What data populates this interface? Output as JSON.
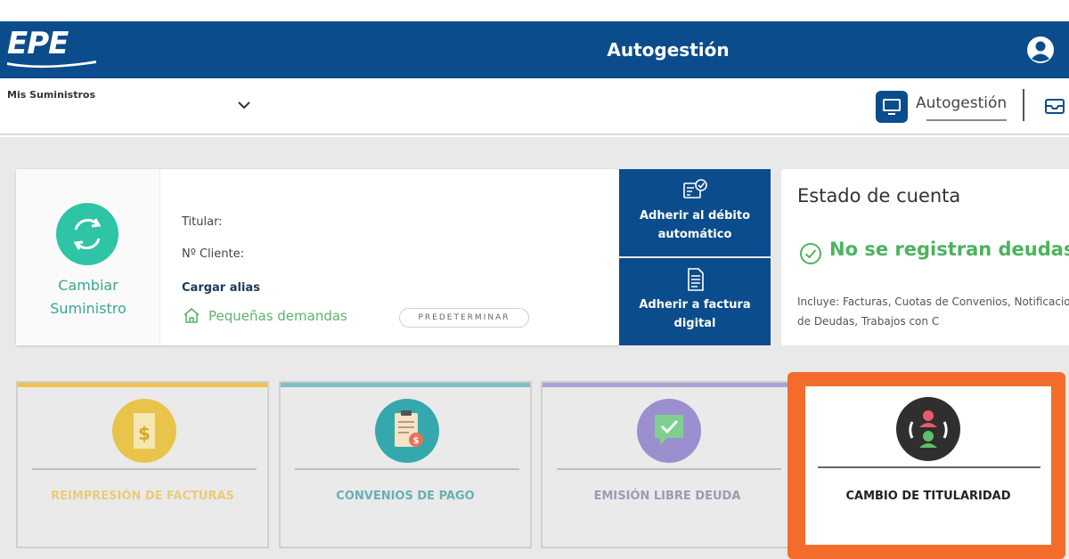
{
  "header": {
    "logo_text": "EPE",
    "title": "Autogestión",
    "user_icon": "user-circle-icon"
  },
  "subnav": {
    "supply_label": "Mis Suministros",
    "nav_label": "Autogestión"
  },
  "supply_card": {
    "change_label_1": "Cambiar",
    "change_label_2": "Suministro",
    "holder_label": "Titular:",
    "client_label": "Nº Cliente:",
    "alias_link": "Cargar alias",
    "category": "Pequeñas demandas",
    "default_tag": "PREDETERMINAR"
  },
  "actions": {
    "debit": "Adherir al débito automático",
    "digital_invoice": "Adherir a factura digital"
  },
  "account_status": {
    "title": "Estado de cuenta",
    "status": "No se registran deudas",
    "includes": "Incluye: Facturas, Cuotas de Convenios, Notificaciones de Deudas, Trabajos con C"
  },
  "tiles": [
    {
      "label": "REIMPRESIÓN DE FACTURAS",
      "icon": "invoice-dollar-icon"
    },
    {
      "label": "CONVENIOS DE PAGO",
      "icon": "clipboard-payment-icon"
    },
    {
      "label": "EMISIÓN LIBRE DEUDA",
      "icon": "chat-check-icon"
    },
    {
      "label": "CAMBIO DE TITULARIDAD",
      "icon": "users-swap-icon"
    }
  ],
  "colors": {
    "brand_blue": "#0b4c8c",
    "success_green": "#4cb35e",
    "highlight_orange": "#f36c2b"
  }
}
